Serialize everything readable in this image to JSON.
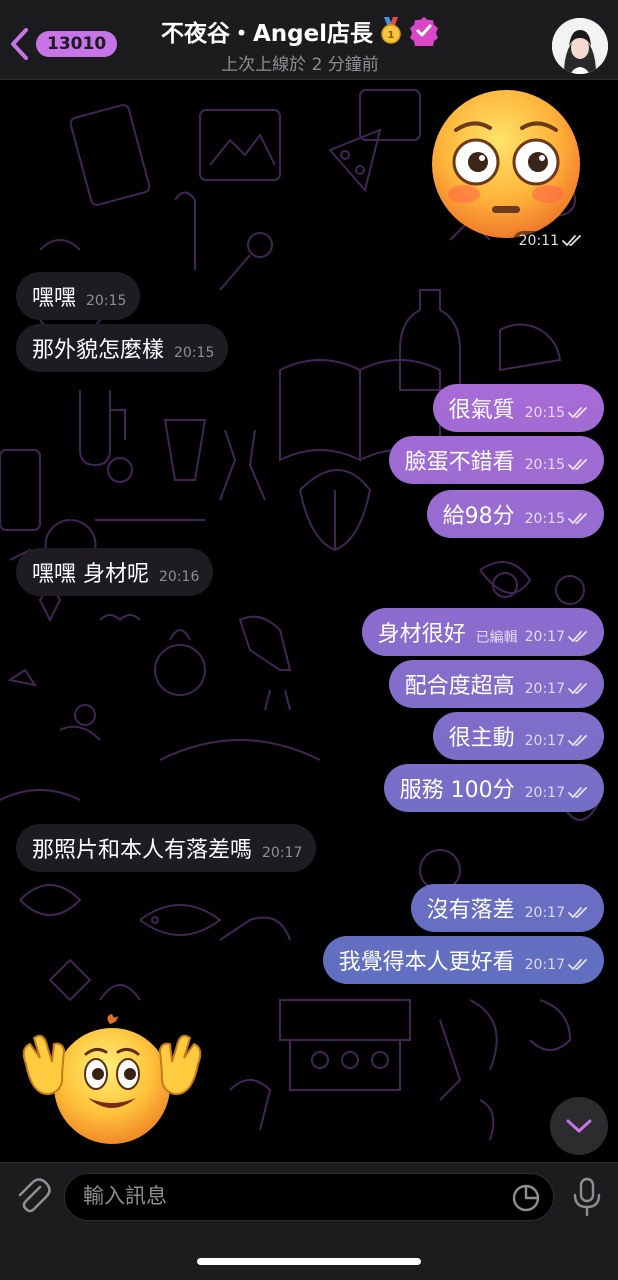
{
  "header": {
    "back_badge": "13010",
    "title": "不夜谷・Angel店長",
    "status": "上次上線於 2 分鐘前"
  },
  "sticker_top": {
    "time": "20:11"
  },
  "messages": [
    {
      "dir": "in",
      "text": "嘿嘿",
      "time": "20:15"
    },
    {
      "dir": "in",
      "text": "那外貌怎麼樣",
      "time": "20:15"
    },
    {
      "dir": "out",
      "text": "很氣質",
      "time": "20:15"
    },
    {
      "dir": "out",
      "text": "臉蛋不錯看",
      "time": "20:15"
    },
    {
      "dir": "out",
      "text": "給98分",
      "time": "20:15"
    },
    {
      "dir": "in",
      "text": "嘿嘿 身材呢",
      "time": "20:16"
    },
    {
      "dir": "out",
      "text": "身材很好",
      "edited": "已編輯",
      "time": "20:17"
    },
    {
      "dir": "out",
      "text": "配合度超高",
      "time": "20:17"
    },
    {
      "dir": "out",
      "text": "很主動",
      "time": "20:17"
    },
    {
      "dir": "out",
      "text": "服務 100分",
      "time": "20:17"
    },
    {
      "dir": "in",
      "text": "那照片和本人有落差嗎",
      "time": "20:17"
    },
    {
      "dir": "out",
      "text": "沒有落差",
      "time": "20:17"
    },
    {
      "dir": "out",
      "text": "我覺得本人更好看",
      "time": "20:17"
    }
  ],
  "input": {
    "placeholder": "輸入訊息"
  },
  "colors": {
    "accent": "#c774e8",
    "outgoing_top": "#a86bd6",
    "outgoing_bottom": "#5f6fc0",
    "incoming": "#1e1b22",
    "doodle": "#4a2a5e"
  },
  "icons": [
    "chevron-left-icon",
    "medal-icon",
    "verified-badge-icon",
    "flushed-face-sticker",
    "double-check-icon",
    "chevron-down-icon",
    "paperclip-icon",
    "sticker-icon",
    "microphone-icon",
    "waving-face-sticker"
  ]
}
